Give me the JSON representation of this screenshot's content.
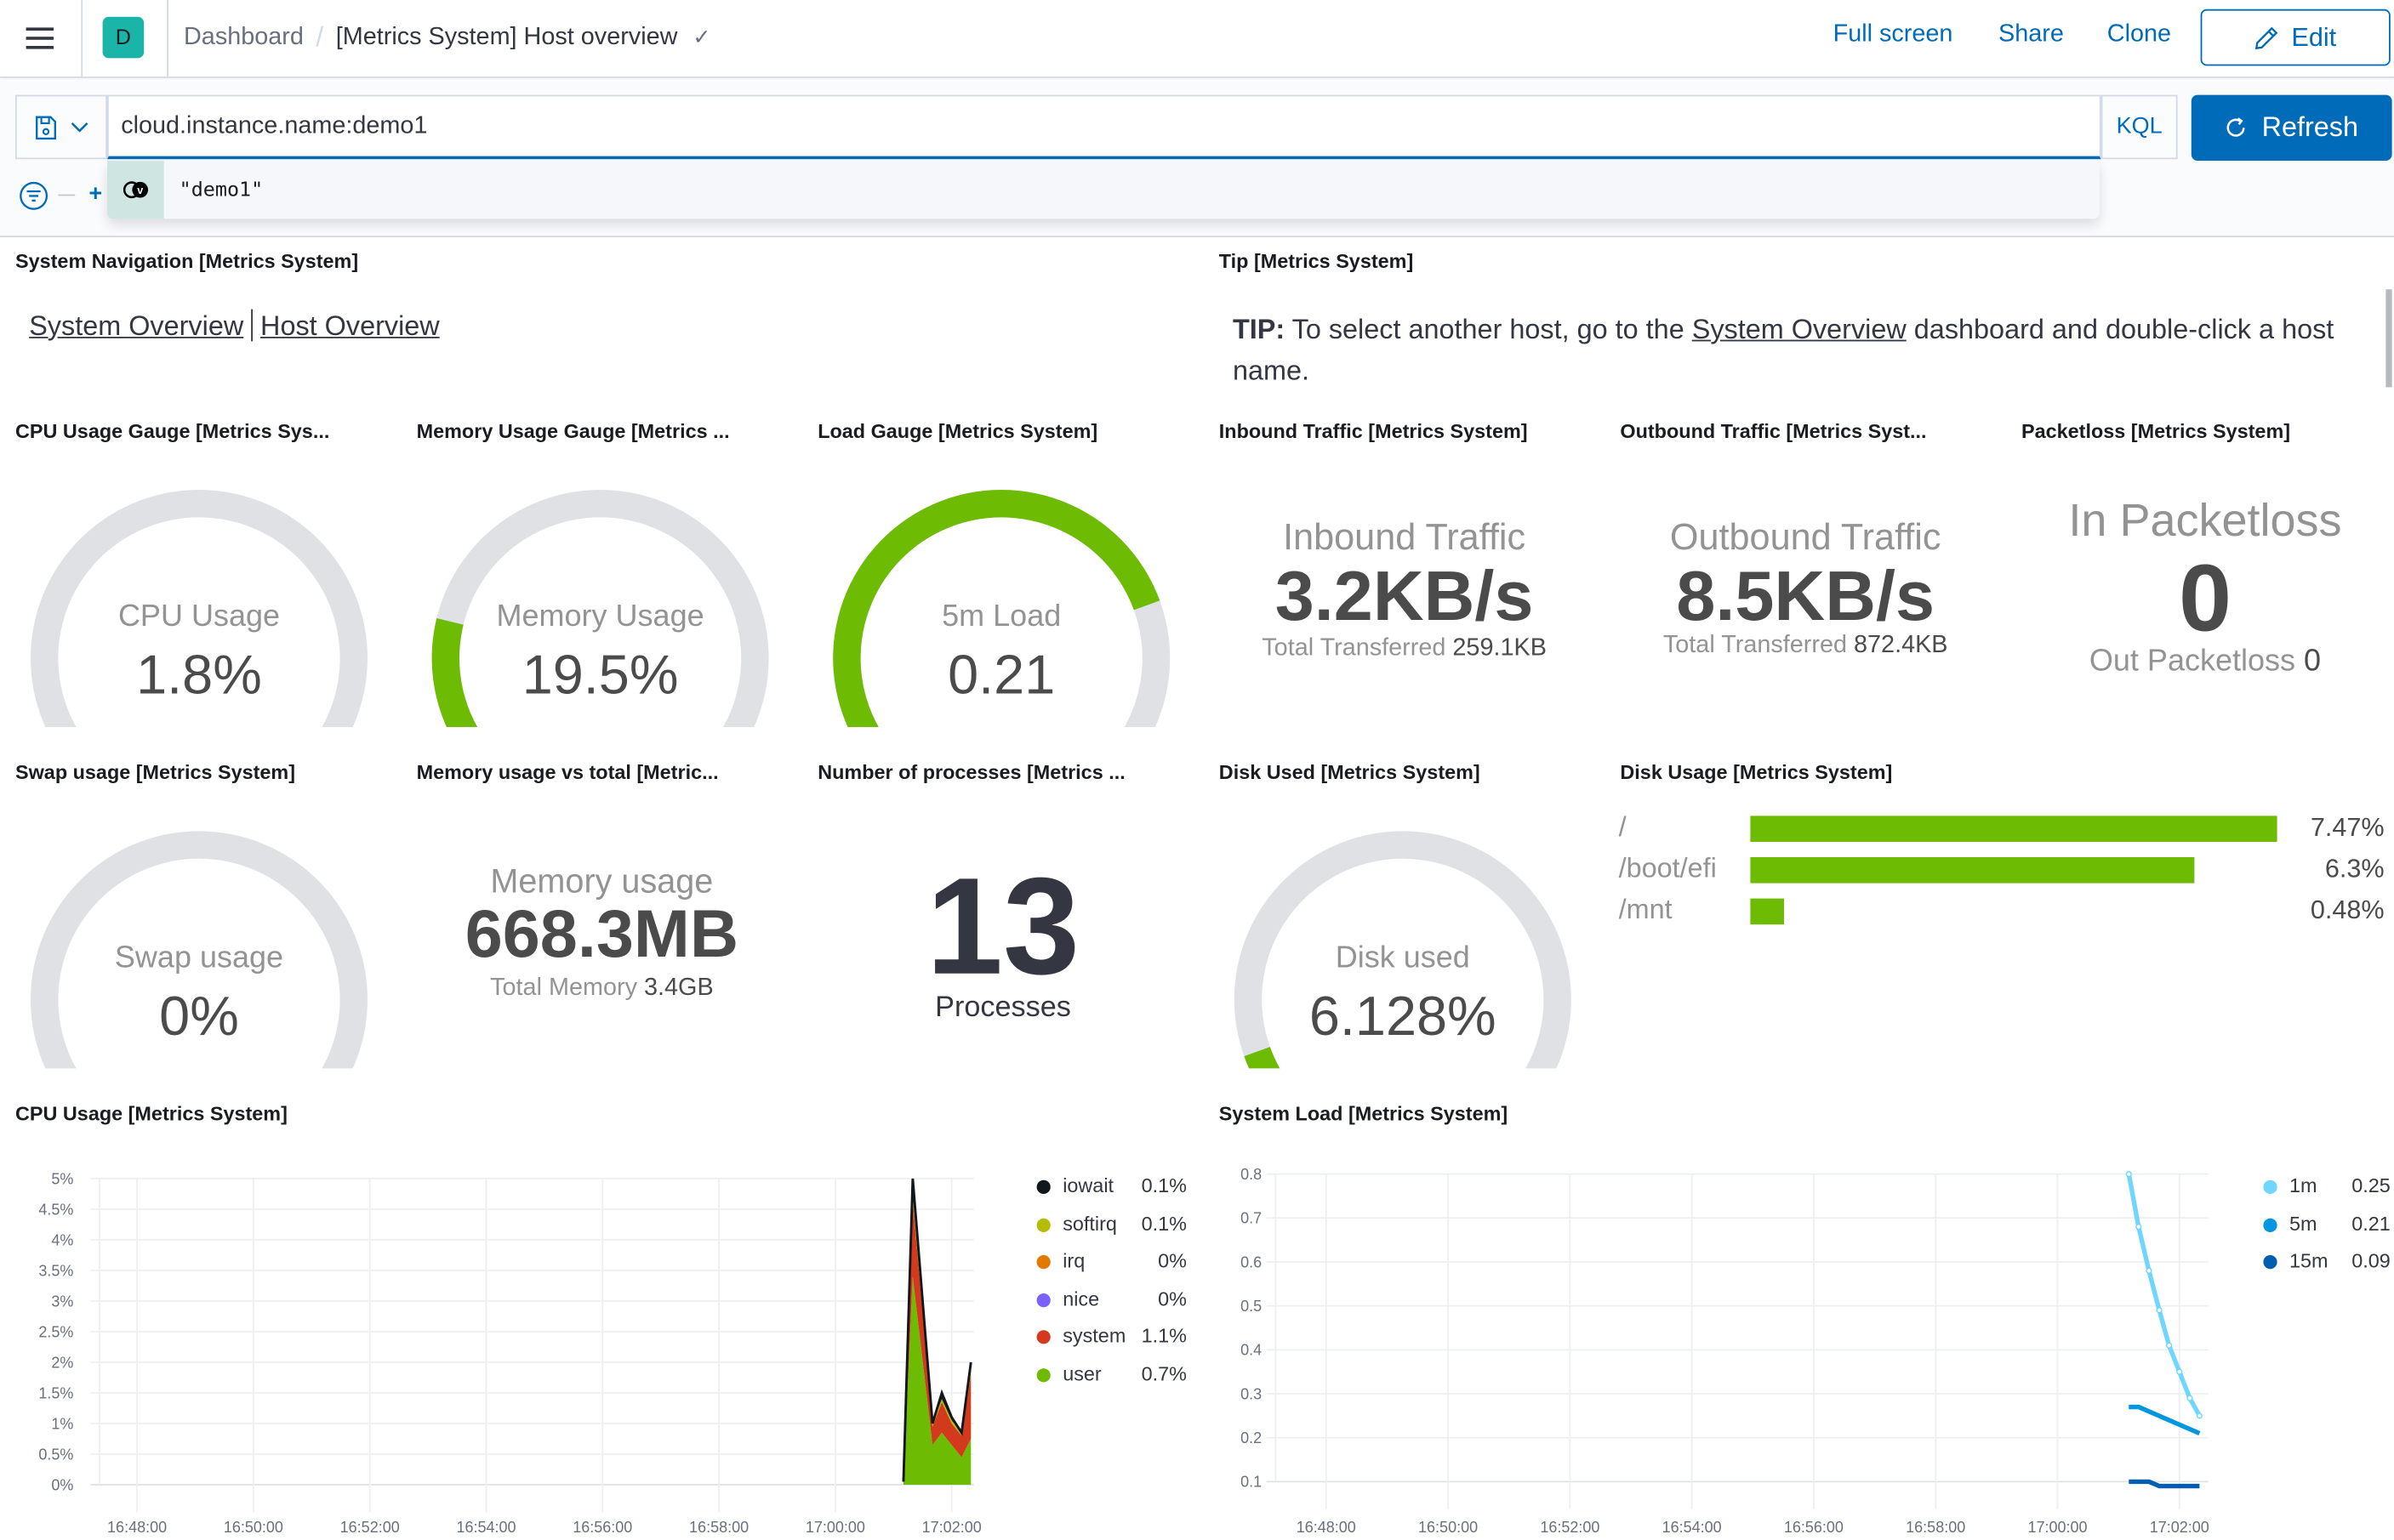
{
  "header": {
    "space_initial": "D",
    "breadcrumb_root": "Dashboard",
    "breadcrumb_current": "[Metrics System] Host overview",
    "links": {
      "full_screen": "Full screen",
      "share": "Share",
      "clone": "Clone"
    },
    "edit_label": "Edit"
  },
  "query": {
    "value": "cloud.instance.name:demo1",
    "language": "KQL",
    "refresh_label": "Refresh",
    "suggestion": "\"demo1\""
  },
  "panels": {
    "system_navigation": {
      "title": "System Navigation [Metrics System]",
      "link1": "System Overview",
      "link2": "Host Overview"
    },
    "tip": {
      "title": "Tip [Metrics System]",
      "bold": "TIP:",
      "text_before": " To select another host, go to the ",
      "link": "System Overview",
      "text_after": " dashboard and double-click a host name."
    },
    "cpu_gauge": {
      "title": "CPU Usage Gauge [Metrics Sys...",
      "label": "CPU Usage",
      "value": "1.8%",
      "fraction": 0.018
    },
    "memory_gauge": {
      "title": "Memory Usage Gauge [Metrics ...",
      "label": "Memory Usage",
      "value": "19.5%",
      "fraction": 0.195
    },
    "load_gauge": {
      "title": "Load Gauge [Metrics System]",
      "label": "5m Load",
      "value": "0.21",
      "fraction": 0.78
    },
    "inbound": {
      "title": "Inbound Traffic [Metrics System]",
      "label": "Inbound Traffic",
      "value": "3.2KB/s",
      "sub_label": "Total Transferred",
      "sub_value": "259.1KB"
    },
    "outbound": {
      "title": "Outbound Traffic [Metrics Syst...",
      "label": "Outbound Traffic",
      "value": "8.5KB/s",
      "sub_label": "Total Transferred",
      "sub_value": "872.4KB"
    },
    "packetloss": {
      "title": "Packetloss [Metrics System]",
      "label": "In Packetloss",
      "value": "0",
      "sub_label": "Out Packetloss",
      "sub_value": "0"
    },
    "swap_gauge": {
      "title": "Swap usage [Metrics System]",
      "label": "Swap usage",
      "value": "0%",
      "fraction": 0
    },
    "memory_total": {
      "title": "Memory usage vs total [Metric...",
      "label": "Memory usage",
      "value": "668.3MB",
      "sub_label": "Total Memory",
      "sub_value": "3.4GB"
    },
    "processes": {
      "title": "Number of processes [Metrics ...",
      "value": "13",
      "label": "Processes"
    },
    "disk_used": {
      "title": "Disk Used [Metrics System]",
      "label": "Disk used",
      "value": "6.128%",
      "fraction": 0.06128
    },
    "disk_usage": {
      "title": "Disk Usage [Metrics System]",
      "rows": [
        {
          "mount": "/",
          "value": "7.47%",
          "pct": 7.47
        },
        {
          "mount": "/boot/efi",
          "value": "6.3%",
          "pct": 6.3
        },
        {
          "mount": "/mnt",
          "value": "0.48%",
          "pct": 0.48
        }
      ]
    },
    "cpu_usage": {
      "title": "CPU Usage [Metrics System]"
    },
    "system_load": {
      "title": "System Load [Metrics System]"
    }
  },
  "colors": {
    "accent": "#006bb8",
    "gauge_fill": "#6dbc03",
    "gauge_track": "#e0e1e5"
  },
  "chart_data": [
    {
      "type": "area",
      "title": "CPU Usage [Metrics System]",
      "stacked": true,
      "ylim": [
        0,
        5
      ],
      "yticks": [
        "0%",
        "0.5%",
        "1%",
        "1.5%",
        "2%",
        "2.5%",
        "3%",
        "3.5%",
        "4%",
        "4.5%",
        "5%"
      ],
      "xticks": [
        "16:48:00",
        "16:50:00",
        "16:52:00",
        "16:54:00",
        "16:56:00",
        "16:58:00",
        "17:00:00",
        "17:02:00"
      ],
      "x_minutes": [
        1021.17,
        1021.33,
        1021.67,
        1021.83,
        1022.0,
        1022.17,
        1022.33
      ],
      "series": [
        {
          "name": "user",
          "color": "#6dbc03",
          "legend_value": "0.7%",
          "values": [
            0.05,
            3.4,
            0.65,
            0.85,
            0.65,
            0.45,
            0.75
          ]
        },
        {
          "name": "system",
          "color": "#d33a1d",
          "legend_value": "1.1%",
          "values": [
            0.0,
            1.25,
            0.3,
            0.5,
            0.35,
            0.35,
            1.05
          ]
        },
        {
          "name": "nice",
          "color": "#7b61ff",
          "legend_value": "0%",
          "values": [
            0,
            0,
            0,
            0,
            0,
            0,
            0
          ]
        },
        {
          "name": "irq",
          "color": "#e27a00",
          "legend_value": "0%",
          "values": [
            0,
            0,
            0,
            0,
            0,
            0,
            0
          ]
        },
        {
          "name": "softirq",
          "color": "#b5bc03",
          "legend_value": "0.1%",
          "values": [
            0.0,
            0.1,
            0.05,
            0.05,
            0.05,
            0.05,
            0.05
          ]
        },
        {
          "name": "iowait",
          "color": "#11171d",
          "legend_value": "0.1%",
          "values": [
            0.0,
            0.25,
            0.0,
            0.1,
            0.05,
            0.0,
            0.15
          ]
        }
      ],
      "legend_order": [
        "iowait",
        "softirq",
        "irq",
        "nice",
        "system",
        "user"
      ],
      "legend": "right"
    },
    {
      "type": "line",
      "title": "System Load [Metrics System]",
      "ylim": [
        0.1,
        0.8
      ],
      "yticks": [
        "0.1",
        "0.2",
        "0.3",
        "0.4",
        "0.5",
        "0.6",
        "0.7",
        "0.8"
      ],
      "xticks": [
        "16:48:00",
        "16:50:00",
        "16:52:00",
        "16:54:00",
        "16:56:00",
        "16:58:00",
        "17:00:00",
        "17:02:00"
      ],
      "series": [
        {
          "name": "1m",
          "color": "#6fd7ff",
          "legend_value": "0.25",
          "x_minutes": [
            1021.17,
            1021.33,
            1021.5,
            1021.67,
            1021.83,
            1022.0,
            1022.17,
            1022.33
          ],
          "values": [
            0.8,
            0.68,
            0.58,
            0.49,
            0.41,
            0.35,
            0.29,
            0.25
          ]
        },
        {
          "name": "5m",
          "color": "#0096e0",
          "legend_value": "0.21",
          "x_minutes": [
            1021.17,
            1021.33,
            1022.33
          ],
          "values": [
            0.27,
            0.27,
            0.21
          ]
        },
        {
          "name": "15m",
          "color": "#005eb0",
          "legend_value": "0.09",
          "x_minutes": [
            1021.17,
            1021.5,
            1021.67,
            1022.33
          ],
          "values": [
            0.1,
            0.1,
            0.09,
            0.09
          ]
        }
      ],
      "legend": "right"
    }
  ]
}
